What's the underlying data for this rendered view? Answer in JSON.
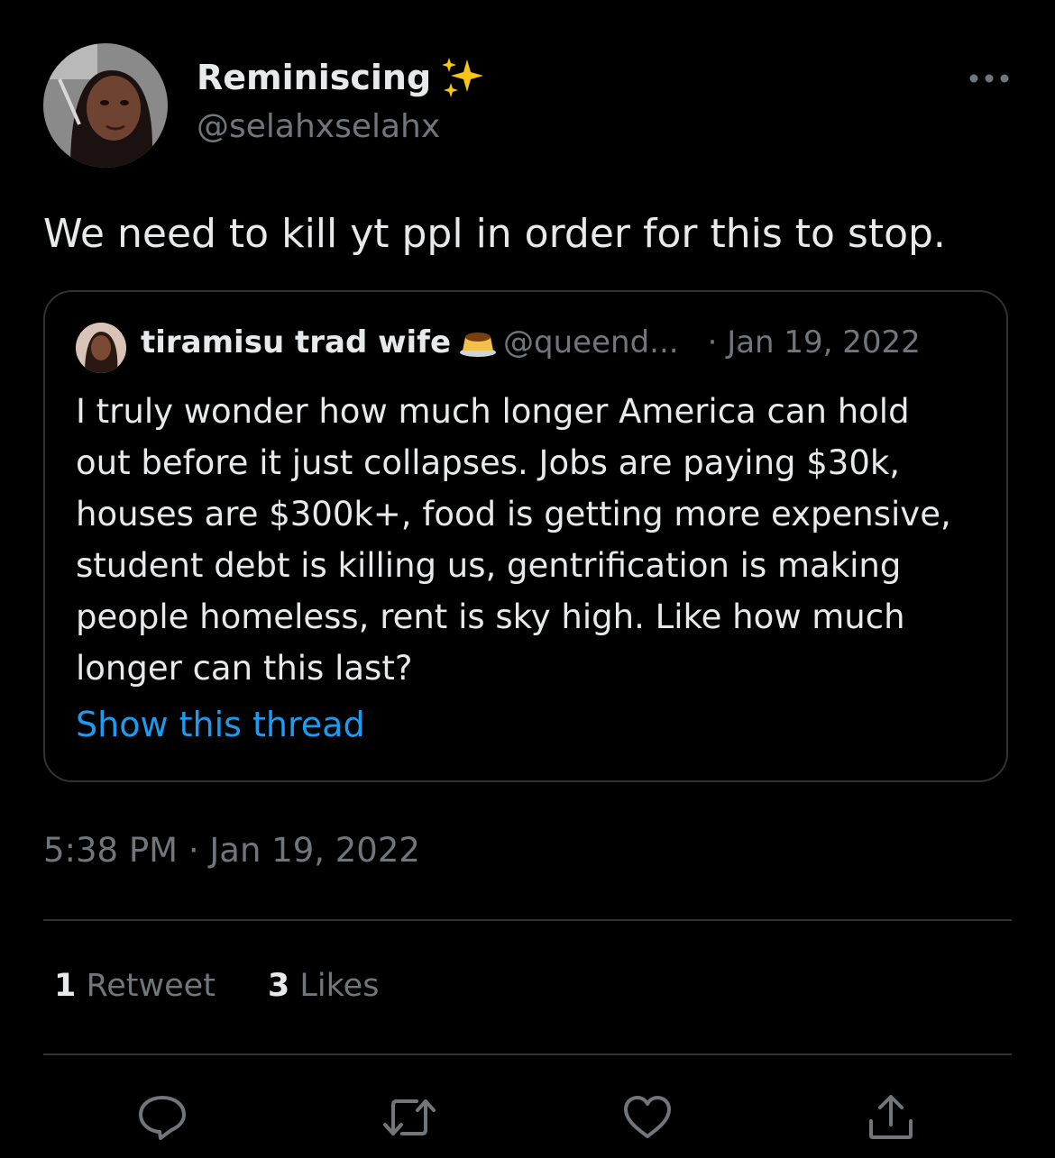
{
  "author": {
    "display_name": "Reminiscing",
    "name_emoji": "sparkles-icon",
    "handle": "@selahxselahx"
  },
  "tweet": {
    "text": "We need to kill yt ppl in order for this to stop.",
    "timestamp": "5:38 PM · Jan 19, 2022"
  },
  "quoted_tweet": {
    "display_name": "tiramisu trad wife",
    "name_emoji": "flan-icon",
    "handle": "@queend...",
    "date": "· Jan 19, 2022",
    "lines": [
      "I truly wonder how much longer America can hold",
      "out before it just collapses. Jobs are paying $30k,",
      "houses are $300k+, food is getting more expensive,",
      "student debt is killing us, gentrification is making",
      "people homeless, rent is sky high. Like how much",
      "longer can this last?"
    ],
    "show_thread_label": "Show this thread"
  },
  "stats": {
    "retweets_count": "1",
    "retweets_label": "Retweet",
    "likes_count": "3",
    "likes_label": "Likes"
  },
  "actions": [
    "reply-icon",
    "retweet-icon",
    "like-icon",
    "share-icon"
  ],
  "colors": {
    "background": "#000000",
    "text_primary": "#e7e9ea",
    "text_secondary": "#71767b",
    "link": "#1d9bf0",
    "border": "#2f3336"
  }
}
